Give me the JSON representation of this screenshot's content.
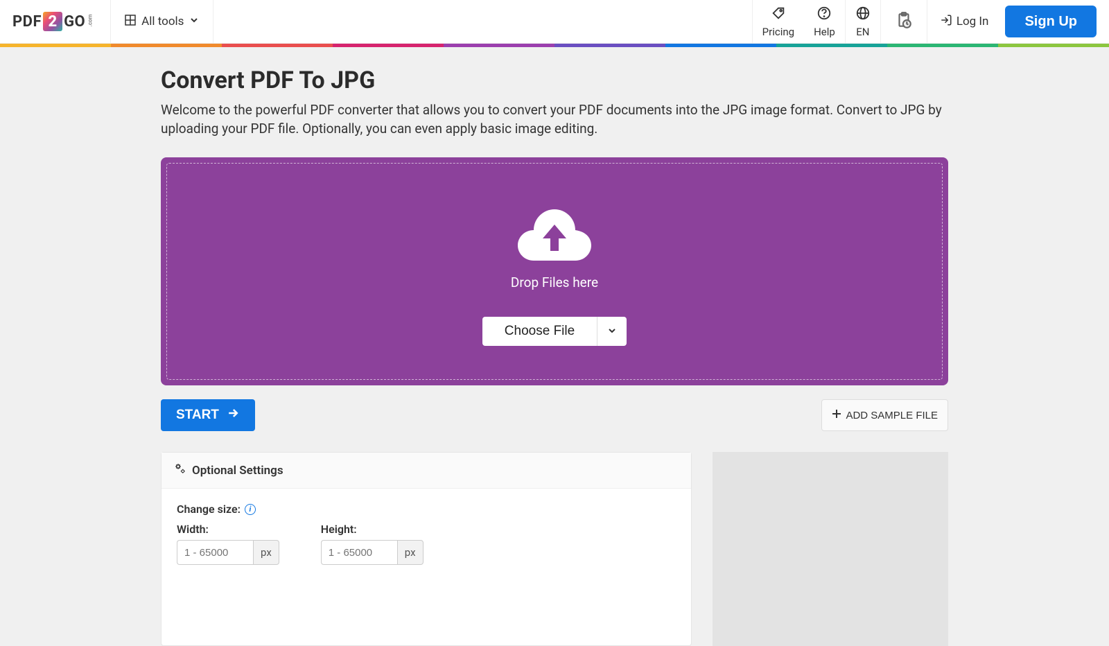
{
  "logo": {
    "left": "PDF",
    "mid": "2",
    "right": "GO",
    "com": ".com"
  },
  "nav": {
    "all_tools": "All tools",
    "pricing": "Pricing",
    "help": "Help",
    "lang": "EN",
    "login": "Log In",
    "signup": "Sign Up"
  },
  "rainbow_colors": [
    "#f6b42c",
    "#f08a2c",
    "#e94e4e",
    "#d6246e",
    "#9b3fae",
    "#6a4fc1",
    "#1277e1",
    "#17a398",
    "#2bb673",
    "#8cc63f"
  ],
  "page": {
    "title": "Convert PDF To JPG",
    "desc": "Welcome to the powerful PDF converter that allows you to convert your PDF documents into the JPG image format. Convert to JPG by uploading your PDF file. Optionally, you can even apply basic image editing."
  },
  "dropzone": {
    "drop_text": "Drop Files here",
    "choose_file": "Choose File"
  },
  "actions": {
    "start": "START",
    "add_sample": "ADD SAMPLE FILE"
  },
  "settings": {
    "header": "Optional Settings",
    "change_size": "Change size:",
    "width_label": "Width:",
    "height_label": "Height:",
    "placeholder": "1 - 65000",
    "unit": "px"
  }
}
